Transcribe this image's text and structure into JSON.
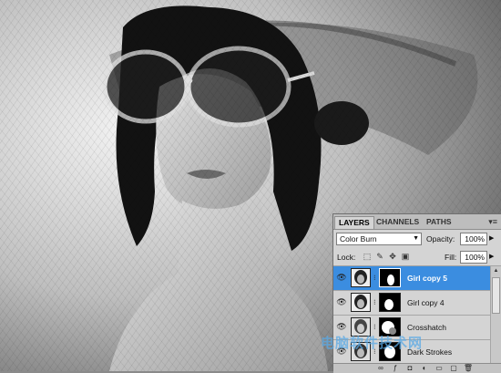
{
  "panel": {
    "tabs": [
      {
        "label": "LAYERS",
        "active": true
      },
      {
        "label": "CHANNELS",
        "active": false
      },
      {
        "label": "PATHS",
        "active": false
      }
    ],
    "menu_icon": "panel-menu-icon",
    "blend_mode": "Color Burn",
    "opacity_label": "Opacity:",
    "opacity_value": "100%",
    "lock_label": "Lock:",
    "lock_icons": [
      "lock-transparent-icon",
      "lock-brush-icon",
      "lock-move-icon",
      "lock-all-icon"
    ],
    "fill_label": "Fill:",
    "fill_value": "100%",
    "layers": [
      {
        "name": "Girl copy 5",
        "selected": true
      },
      {
        "name": "Girl copy 4",
        "selected": false
      },
      {
        "name": "Crosshatch",
        "selected": false
      },
      {
        "name": "Dark Strokes",
        "selected": false
      }
    ],
    "bottom_icons": [
      "link-layers-icon",
      "fx-icon",
      "add-mask-icon",
      "adjustment-icon",
      "group-icon",
      "new-layer-icon",
      "delete-icon"
    ]
  },
  "watermark": "电脑软件技术网",
  "colors": {
    "selected_layer": "#3b8de0",
    "panel_bg": "#d4d4d4"
  }
}
